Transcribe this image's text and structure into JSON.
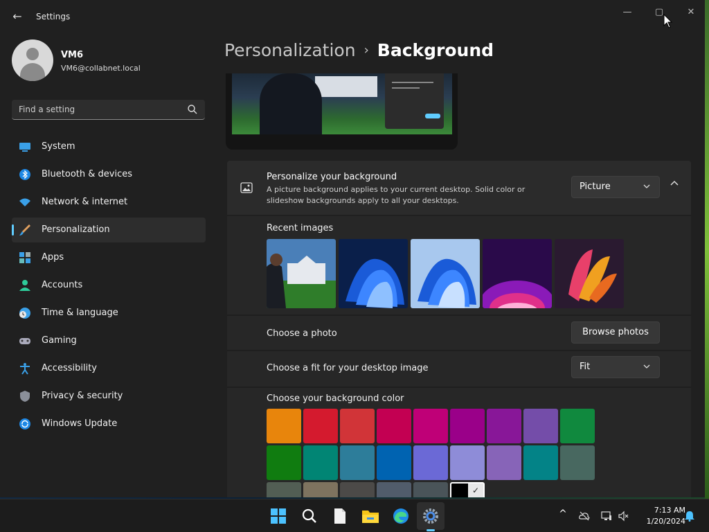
{
  "window": {
    "title": "Settings",
    "back_glyph": "←",
    "minimize_glyph": "—",
    "maximize_glyph": "▢",
    "close_glyph": "✕"
  },
  "user": {
    "name": "VM6",
    "email": "VM6@collabnet.local"
  },
  "search": {
    "placeholder": "Find a setting"
  },
  "sidebar": {
    "items": [
      {
        "label": "System",
        "icon": "system-icon"
      },
      {
        "label": "Bluetooth & devices",
        "icon": "bluetooth-icon"
      },
      {
        "label": "Network & internet",
        "icon": "wifi-icon"
      },
      {
        "label": "Personalization",
        "icon": "brush-icon",
        "active": true
      },
      {
        "label": "Apps",
        "icon": "apps-icon"
      },
      {
        "label": "Accounts",
        "icon": "person-icon"
      },
      {
        "label": "Time & language",
        "icon": "clock-globe-icon"
      },
      {
        "label": "Gaming",
        "icon": "gamepad-icon"
      },
      {
        "label": "Accessibility",
        "icon": "accessibility-icon"
      },
      {
        "label": "Privacy & security",
        "icon": "shield-icon"
      },
      {
        "label": "Windows Update",
        "icon": "update-icon"
      }
    ]
  },
  "breadcrumb": {
    "parent": "Personalization",
    "separator": "›",
    "current": "Background"
  },
  "personalize": {
    "title": "Personalize your background",
    "description": "A picture background applies to your current desktop. Solid color or slideshow backgrounds apply to all your desktops.",
    "selected": "Picture"
  },
  "recent_images": {
    "label": "Recent images",
    "items": [
      "white-house-photo",
      "blue-bloom-dark",
      "blue-bloom-light",
      "purple-glow",
      "colorful-ribbon"
    ]
  },
  "choose_photo": {
    "label": "Choose a photo",
    "button": "Browse photos"
  },
  "fit": {
    "label": "Choose a fit for your desktop image",
    "selected": "Fit"
  },
  "background_color": {
    "label": "Choose your background color",
    "colors": [
      "#e8850c",
      "#d41a2e",
      "#d13438",
      "#c30052",
      "#bf0077",
      "#9a0089",
      "#881798",
      "#744da9",
      "#10893e",
      "#107c10",
      "#018574",
      "#2d7d9a",
      "#0063b1",
      "#6b69d6",
      "#8e8cd8",
      "#8764b8",
      "#038387",
      "#486860",
      "#525e54",
      "#7e735f",
      "#4c4a48",
      "#515c6b",
      "#4a5459",
      "#000000"
    ],
    "selected_index": 23,
    "check_glyph": "✓"
  },
  "taskbar": {
    "apps": [
      "start-icon",
      "search-icon",
      "file-icon",
      "file-explorer-icon",
      "edge-icon",
      "settings-icon"
    ],
    "time": "7:13 AM",
    "date": "1/20/2024",
    "chevron_glyph": "^"
  }
}
